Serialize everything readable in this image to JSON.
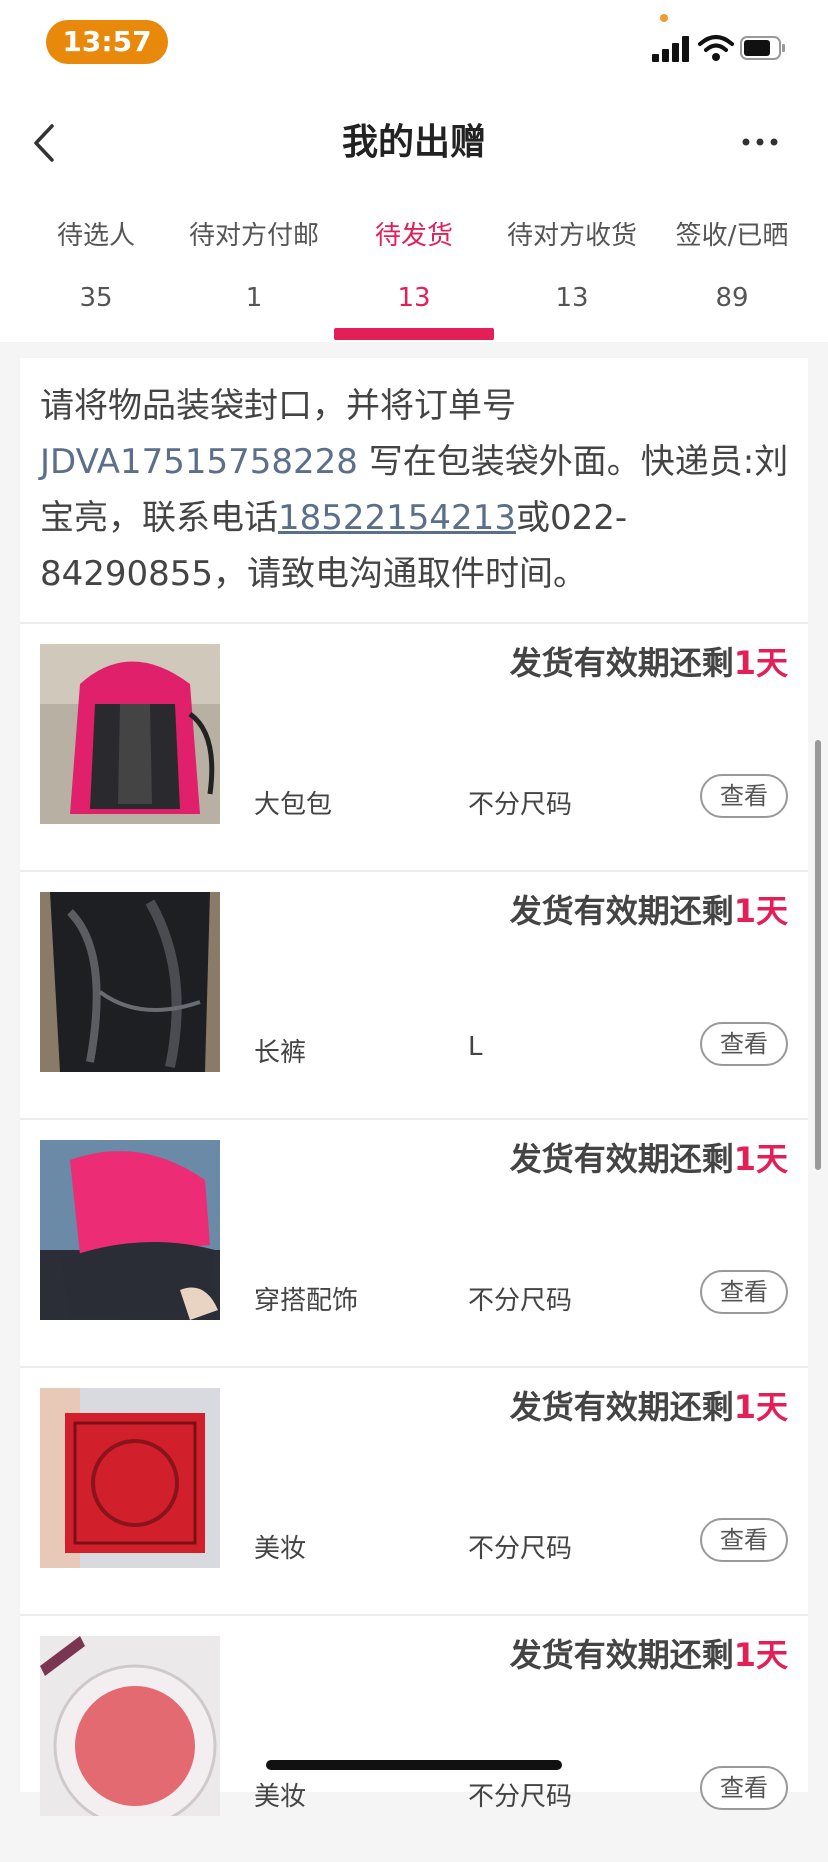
{
  "status_bar": {
    "time": "13:57"
  },
  "nav": {
    "title": "我的出赠"
  },
  "tabs": [
    {
      "label": "待选人",
      "count": "35"
    },
    {
      "label": "待对方付邮",
      "count": "1"
    },
    {
      "label": "待发货",
      "count": "13"
    },
    {
      "label": "待对方收货",
      "count": "13"
    },
    {
      "label": "签收/已晒",
      "count": "89"
    }
  ],
  "notice": {
    "prefix": "请将物品装袋封口，并将订单号 ",
    "order_number": "JDVA17515758228",
    "middle": " 写在包装袋外面。快递员:刘宝亮，联系电话",
    "phone": "18522154213",
    "suffix": "或022-84290855，请致电沟通取件时间。"
  },
  "items": [
    {
      "deadline_prefix": "发货有效期还剩",
      "deadline_days": "1天",
      "name": "大包包",
      "size": "不分尺码",
      "view_label": "查看"
    },
    {
      "deadline_prefix": "发货有效期还剩",
      "deadline_days": "1天",
      "name": "长裤",
      "size": "L",
      "view_label": "查看"
    },
    {
      "deadline_prefix": "发货有效期还剩",
      "deadline_days": "1天",
      "name": "穿搭配饰",
      "size": "不分尺码",
      "view_label": "查看"
    },
    {
      "deadline_prefix": "发货有效期还剩",
      "deadline_days": "1天",
      "name": "美妆",
      "size": "不分尺码",
      "view_label": "查看"
    },
    {
      "deadline_prefix": "发货有效期还剩",
      "deadline_days": "1天",
      "name": "美妆",
      "size": "不分尺码",
      "view_label": "查看"
    }
  ],
  "colors": {
    "accent": "#e41f57",
    "time_pill": "#e8890b",
    "link": "#5b6f8a"
  }
}
